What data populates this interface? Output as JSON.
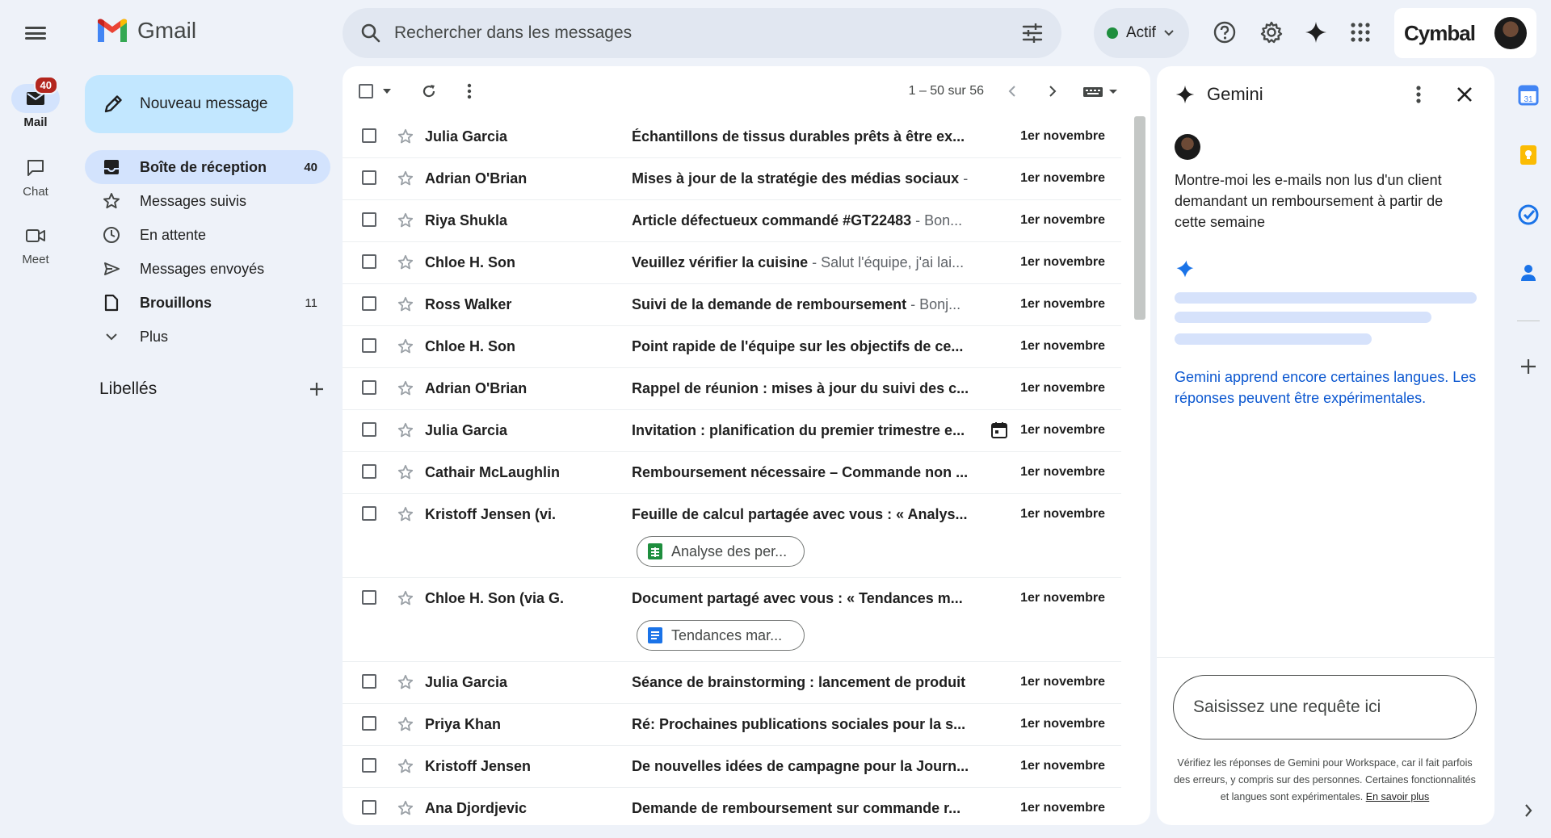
{
  "app": {
    "name": "Gmail"
  },
  "rail": {
    "items": [
      {
        "label": "Mail",
        "badge": "40",
        "icon": "mail-icon"
      },
      {
        "label": "Chat",
        "icon": "chat-icon"
      },
      {
        "label": "Meet",
        "icon": "video-icon"
      }
    ]
  },
  "search": {
    "placeholder": "Rechercher dans les messages"
  },
  "status": {
    "label": "Actif",
    "color": "#1e8e3e"
  },
  "account": {
    "brand": "Cymbal"
  },
  "compose": {
    "label": "Nouveau message"
  },
  "nav": {
    "items": [
      {
        "label": "Boîte de réception",
        "count": "40",
        "icon": "inbox-icon"
      },
      {
        "label": "Messages suivis",
        "count": "",
        "icon": "star-icon"
      },
      {
        "label": "En attente",
        "count": "",
        "icon": "clock-icon"
      },
      {
        "label": "Messages envoyés",
        "count": "",
        "icon": "send-icon"
      },
      {
        "label": "Brouillons",
        "count": "11",
        "icon": "draft-icon"
      },
      {
        "label": "Plus",
        "count": "",
        "icon": "chevron-down-icon"
      }
    ],
    "labels_heading": "Libellés"
  },
  "toolbar": {
    "range": "1 – 50 sur 56"
  },
  "emails": [
    {
      "from": "Julia Garcia",
      "subject": "Échantillons de tissus durables prêts à être ex...",
      "snippet": "",
      "date": "1er novembre"
    },
    {
      "from": "Adrian O'Brian",
      "subject": "Mises à jour de la stratégie des médias sociaux",
      "snippet": " -",
      "date": "1er novembre"
    },
    {
      "from": "Riya Shukla",
      "subject": "Article défectueux commandé #GT22483",
      "snippet": " - Bon...",
      "date": "1er novembre"
    },
    {
      "from": "Chloe H. Son",
      "subject": "Veuillez vérifier la cuisine",
      "snippet": " - Salut l'équipe, j'ai lai...",
      "date": "1er novembre"
    },
    {
      "from": "Ross Walker",
      "subject": "Suivi de la demande de remboursement",
      "snippet": " - Bonj...",
      "date": "1er novembre"
    },
    {
      "from": "Chloe H. Son",
      "subject": "Point rapide de l'équipe sur les objectifs de ce...",
      "snippet": "",
      "date": "1er novembre"
    },
    {
      "from": "Adrian O'Brian",
      "subject": "Rappel de réunion : mises à jour du suivi des c...",
      "snippet": "",
      "date": "1er novembre"
    },
    {
      "from": "Julia Garcia",
      "subject": "Invitation : planification du premier trimestre e...",
      "snippet": "",
      "date": "1er novembre",
      "calendar": true
    },
    {
      "from": "Cathair McLaughlin",
      "subject": "Remboursement nécessaire – Commande non ...",
      "snippet": "",
      "date": "1er novembre"
    },
    {
      "from": "Kristoff Jensen (vi.",
      "subject": "Feuille de calcul partagée avec vous : « Analys...",
      "snippet": "",
      "date": "1er novembre",
      "attachment": {
        "label": "Analyse des per...",
        "type": "sheets",
        "color": "#1e8e3e"
      }
    },
    {
      "from": "Chloe H. Son (via G.",
      "subject": "Document partagé avec vous : « Tendances m...",
      "snippet": "",
      "date": "1er novembre",
      "attachment": {
        "label": "Tendances mar...",
        "type": "docs",
        "color": "#1a73e8"
      }
    },
    {
      "from": "Julia Garcia",
      "subject": "Séance de brainstorming : lancement de produit",
      "snippet": "",
      "date": "1er novembre"
    },
    {
      "from": "Priya Khan",
      "subject": "Ré: Prochaines publications sociales pour la s...",
      "snippet": "",
      "date": "1er novembre"
    },
    {
      "from": "Kristoff Jensen",
      "subject": "De nouvelles idées de campagne pour la Journ...",
      "snippet": "",
      "date": "1er novembre"
    },
    {
      "from": "Ana Djordjevic",
      "subject": "Demande de remboursement sur commande r...",
      "snippet": "",
      "date": "1er novembre"
    }
  ],
  "gemini": {
    "title": "Gemini",
    "prompt": "Montre-moi les e-mails non lus d'un client demandant un remboursement à partir de cette semaine",
    "note": "Gemini apprend encore certaines langues. Les réponses peuvent être expérimentales.",
    "input_placeholder": "Saisissez une requête ici",
    "footer": "Vérifiez les réponses de Gemini pour Workspace, car il fait parfois des erreurs, y compris sur des personnes. Certaines fonctionnalités et langues sont expérimentales.",
    "footer_link": "En savoir plus"
  },
  "side_apps": [
    "calendar-icon",
    "keep-icon",
    "tasks-icon",
    "contacts-icon",
    "add-icon"
  ],
  "colors": {
    "accent": "#0b57d0",
    "compose_bg": "#c2e7ff",
    "active_nav": "#d3e3fd",
    "badge": "#b3261e"
  }
}
